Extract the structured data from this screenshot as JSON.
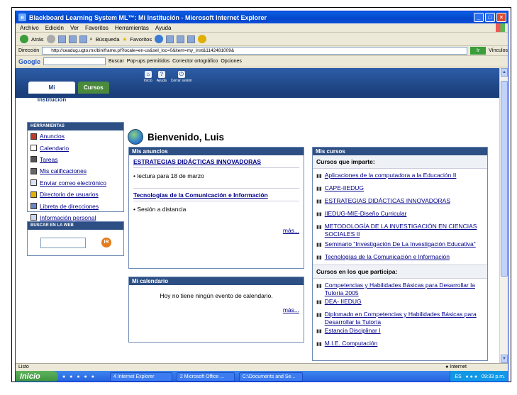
{
  "window": {
    "title": "Blackboard Learning System ML™: Mi Institución - Microsoft Internet Explorer"
  },
  "menu": [
    "Archivo",
    "Edición",
    "Ver",
    "Favoritos",
    "Herramientas",
    "Ayuda"
  ],
  "toolbar": {
    "back": "Atrás",
    "search": "Búsqueda",
    "favorites": "Favoritos"
  },
  "address": {
    "label": "Dirección",
    "url": "http://ceadug.ugto.mx/bin/frame.pl?locale=en-us&sel_loc=0&item=my_inst&1142481009&",
    "go": "Ir",
    "links": "Vínculos"
  },
  "google": {
    "logo": "Google",
    "buscar": "Buscar",
    "popups": "Pop-ups permitidos",
    "spell": "Corrector ortográfico",
    "options": "Opciones"
  },
  "header": {
    "tab_active": "Mi Institución",
    "tab_courses": "Cursos",
    "icons": [
      "Inicio",
      "Ayuda",
      "Cerrar sesión"
    ]
  },
  "tools": {
    "title": "HERRAMIENTAS",
    "items": [
      {
        "label": "Anuncios",
        "color": "#c0392b"
      },
      {
        "label": "Calendario",
        "color": "#2d4f84"
      },
      {
        "label": "Tareas",
        "color": "#333333"
      },
      {
        "label": "Mis calificaciones",
        "color": "#333333"
      },
      {
        "label": "Enviar correo electrónico",
        "color": "#2d4f84"
      },
      {
        "label": "Directorio de usuarios",
        "color": "#b8860b"
      },
      {
        "label": "Libreta de direcciones",
        "color": "#2d4f84"
      },
      {
        "label": "Información personal",
        "color": "#2d4f84"
      }
    ]
  },
  "web_search": {
    "title": "BUSCAR EN LA WEB",
    "go": "IR"
  },
  "welcome": "Bienvenido, Luis",
  "announcements": {
    "title": "Mis anuncios",
    "course1": "ESTRATEGIAS DIDÁCTICAS INNOVADORAS",
    "item1": "lectura para 18 de marzo",
    "course2": "Tecnologías de la Comunicación e Información",
    "item2": "Sesión a distancia",
    "more": "más..."
  },
  "calendar": {
    "title": "Mi calendario",
    "empty": "Hoy no tiene ningún evento de calendario.",
    "more": "más..."
  },
  "courses": {
    "title": "Mis cursos",
    "teaching_header": "Cursos que imparte:",
    "teaching": [
      "Aplicaciones de la computadora a la Educación II",
      "CAPE-IIEDUG",
      "ESTRATEGIAS DIDÁCTICAS INNOVADORAS",
      "IIEDUG-MIE-Diseño Curricular",
      "METODOLOGÍA DE LA INVESTIGACIÓN EN CIENCIAS SOCIALES II",
      "Seminario \"Investigación De La Investigación Educativa\"",
      "Tecnologías de la Comunicación e Información"
    ],
    "participating_header": "Cursos en los que participa:",
    "participating": [
      "Competencias y Habilidades Básicas para Desarrollar la Tutoría 2005",
      "DEA- IIEDUG",
      "Diplomado en Competencias y Habilidades Básicas para Desarrollar la Tutoría",
      "Estancia Disciplinar I",
      "M.I.E. Computación"
    ]
  },
  "status": {
    "left": "Listo",
    "zone": "Internet"
  },
  "taskbar": {
    "start": "Inicio",
    "tasks": [
      "4 Internet Explorer",
      "2 Microsoft Office ...",
      "C:\\Documents and Se..."
    ],
    "lang": "ES",
    "time": "09:33 p.m."
  }
}
